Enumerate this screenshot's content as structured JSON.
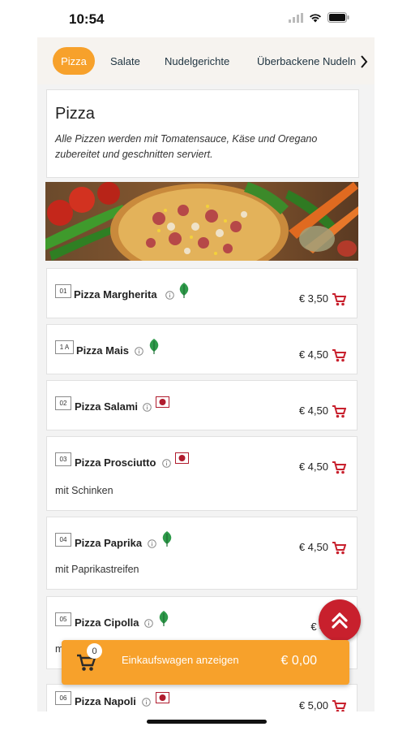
{
  "status": {
    "time": "10:54"
  },
  "tabs": [
    {
      "label": "Pizza",
      "active": true
    },
    {
      "label": "Salate",
      "active": false
    },
    {
      "label": "Nudelgerichte",
      "active": false
    },
    {
      "label": "Überbackene Nudeln",
      "active": false
    }
  ],
  "category": {
    "title": "Pizza",
    "description": "Alle Pizzen werden mit Tomatensauce, Käse und Oregano zubereitet und geschnitten serviert."
  },
  "items": [
    {
      "number": "01",
      "name": "Pizza Margherita",
      "diet": "leaf-icon",
      "price": "€ 3,50",
      "desc": ""
    },
    {
      "number": "1 A",
      "name": "Pizza Mais",
      "diet": "leaf-icon",
      "price": "€ 4,50",
      "desc": ""
    },
    {
      "number": "02",
      "name": "Pizza Salami",
      "diet": "meat-icon",
      "price": "€ 4,50",
      "desc": ""
    },
    {
      "number": "03",
      "name": "Pizza Prosciutto",
      "diet": "meat-icon",
      "price": "€ 4,50",
      "desc": "mit Schinken"
    },
    {
      "number": "04",
      "name": "Pizza Paprika",
      "diet": "leaf-icon",
      "price": "€ 4,50",
      "desc": "mit Paprikastreifen"
    },
    {
      "number": "05",
      "name": "Pizza Cipolla",
      "diet": "leaf-icon",
      "price": "€ 4,",
      "desc": "m"
    },
    {
      "number": "06",
      "name": "Pizza Napoli",
      "diet": "meat-icon",
      "price": "€ 5,00",
      "desc": ""
    }
  ],
  "cart": {
    "count": "0",
    "label": "Einkaufswagen anzeigen",
    "total": "€ 0,00"
  },
  "colors": {
    "accent": "#f7a12b",
    "fab": "#c8202d",
    "cart_icon": "#c8202d",
    "leaf": "#2e9a4a",
    "meat": "#b01c2e"
  }
}
